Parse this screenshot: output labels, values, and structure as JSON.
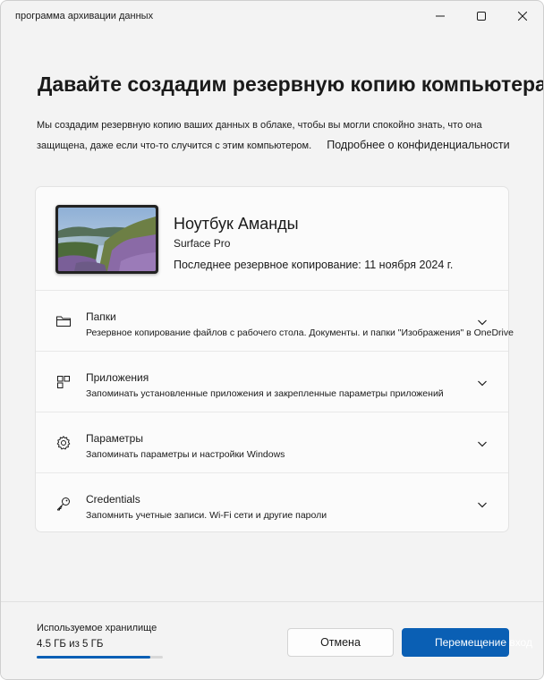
{
  "window": {
    "title": "программа архивации данных"
  },
  "header": {
    "heading": "Давайте создадим резервную копию компьютера",
    "intro": "Мы создадим резервную копию ваших данных в облаке, чтобы вы могли спокойно знать, что она защищена, даже если что-то случится с этим компьютером.",
    "privacy_link": "Подробнее о конфиденциальности"
  },
  "device": {
    "name": "Ноутбук Аманды",
    "model": "Surface Pro",
    "last_backup": "Последнее резервное копирование: 11 ноября 2024 г."
  },
  "sections": [
    {
      "icon": "folder-icon",
      "title": "Папки",
      "description": "Резервное копирование файлов с рабочего стола. Документы. и папки \"Изображения\" в OneDrive"
    },
    {
      "icon": "apps-icon",
      "title": "Приложения",
      "description": "Запоминать установленные приложения и закрепленные параметры приложений"
    },
    {
      "icon": "gear-icon",
      "title": "Параметры",
      "description": "Запоминать параметры и настройки Windows"
    },
    {
      "icon": "key-icon",
      "title": "Credentials",
      "description": "Запомнить учетные записи. Wi-Fi сети и другие пароли"
    }
  ],
  "footer": {
    "storage_label": "Используемое хранилище",
    "storage_value": "4.5 ГБ из 5 ГБ",
    "storage_fraction": 0.9,
    "cancel_label": "Отмена",
    "primary_label": "Перемещение вход"
  },
  "colors": {
    "accent": "#0a5fb4",
    "background": "#f3f3f3",
    "card": "#fbfbfb"
  }
}
